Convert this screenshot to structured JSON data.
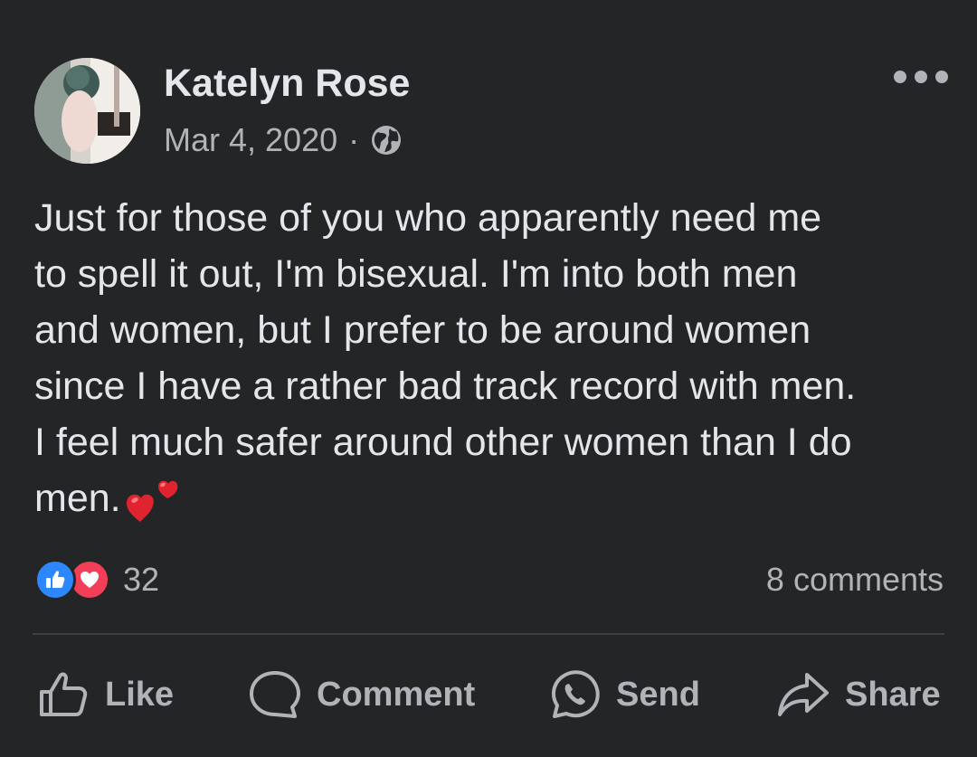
{
  "post": {
    "author": "Katelyn Rose",
    "date": "Mar 4, 2020",
    "separator": "·",
    "privacy_icon": "globe-icon",
    "text_lines": [
      "Just for those of you who apparently need me",
      "to spell it out, I'm bisexual. I'm into both men",
      "and women, but I prefer to be around women",
      "since I have a rather bad track record with men.",
      "I feel much safer around other women than I do",
      "men."
    ],
    "emoji": "two-hearts-emoji"
  },
  "reactions": {
    "types": [
      "like-reaction-icon",
      "love-reaction-icon"
    ],
    "count": "32",
    "comments": "8 comments"
  },
  "actions": {
    "like": "Like",
    "comment": "Comment",
    "send": "Send",
    "share": "Share"
  },
  "colors": {
    "background": "#242526",
    "text": "#e4e6eb",
    "secondary": "#b0b3b8",
    "like_blue": "#2d88ff",
    "love_red": "#f33e58"
  }
}
